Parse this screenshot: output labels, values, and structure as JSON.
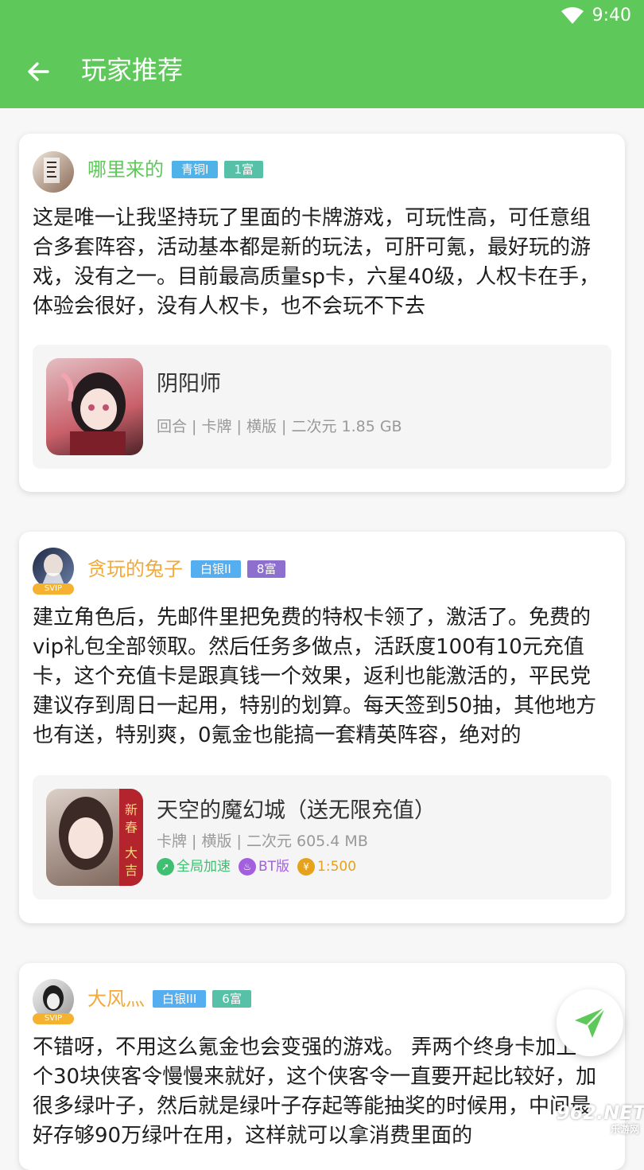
{
  "status": {
    "time": "9:40"
  },
  "header": {
    "title": "玩家推荐"
  },
  "colors": {
    "primary": "#5ec95a"
  },
  "reviews": [
    {
      "username": "哪里来的",
      "level": "青铜I",
      "wealth": "1富",
      "text": "这是唯一让我坚持玩了里面的卡牌游戏，可玩性高，可任意组合多套阵容，活动基本都是新的玩法，可肝可氪，最好玩的游戏，没有之一。目前最高质量sp卡，六星40级，人权卡在手，体验会很好，没有人权卡，也不会玩不下去",
      "game": {
        "name": "阴阳师",
        "meta": "回合 | 卡牌 | 横版 | 二次元 1.85 GB"
      }
    },
    {
      "username": "贪玩的兔子",
      "vip": "SVIP",
      "level": "白银II",
      "wealth": "8富",
      "text": "建立角色后，先邮件里把免费的特权卡领了，激活了。免费的vip礼包全部领取。然后任务多做点，活跃度100有10元充值卡，这个充值卡是跟真钱一个效果，返利也能激活的，平民党建议存到周日一起用，特别的划算。每天签到50抽，其他地方也有送，特别爽，0氪金也能搞一套精英阵容，绝对的",
      "game": {
        "name": "天空的魔幻城（送无限充值）",
        "meta": "卡牌 | 横版 | 二次元 605.4 MB",
        "tags": [
          "全局加速",
          "BT版",
          "1:500"
        ]
      }
    },
    {
      "username": "大风灬",
      "vip": "SVIP",
      "level": "白银III",
      "wealth": "6富",
      "text": "不错呀，不用这么氪金也会变强的游戏。 弄两个终身卡加上一个30块侠客令慢慢来就好，这个侠客令一直要开起比较好，加很多绿叶子，然后就是绿叶子存起等能抽奖的时候用，中间最好存够90万绿叶在用，这样就可以拿消费里面的"
    }
  ],
  "watermark": {
    "brand": "962.NET",
    "sub": "乐游网"
  }
}
